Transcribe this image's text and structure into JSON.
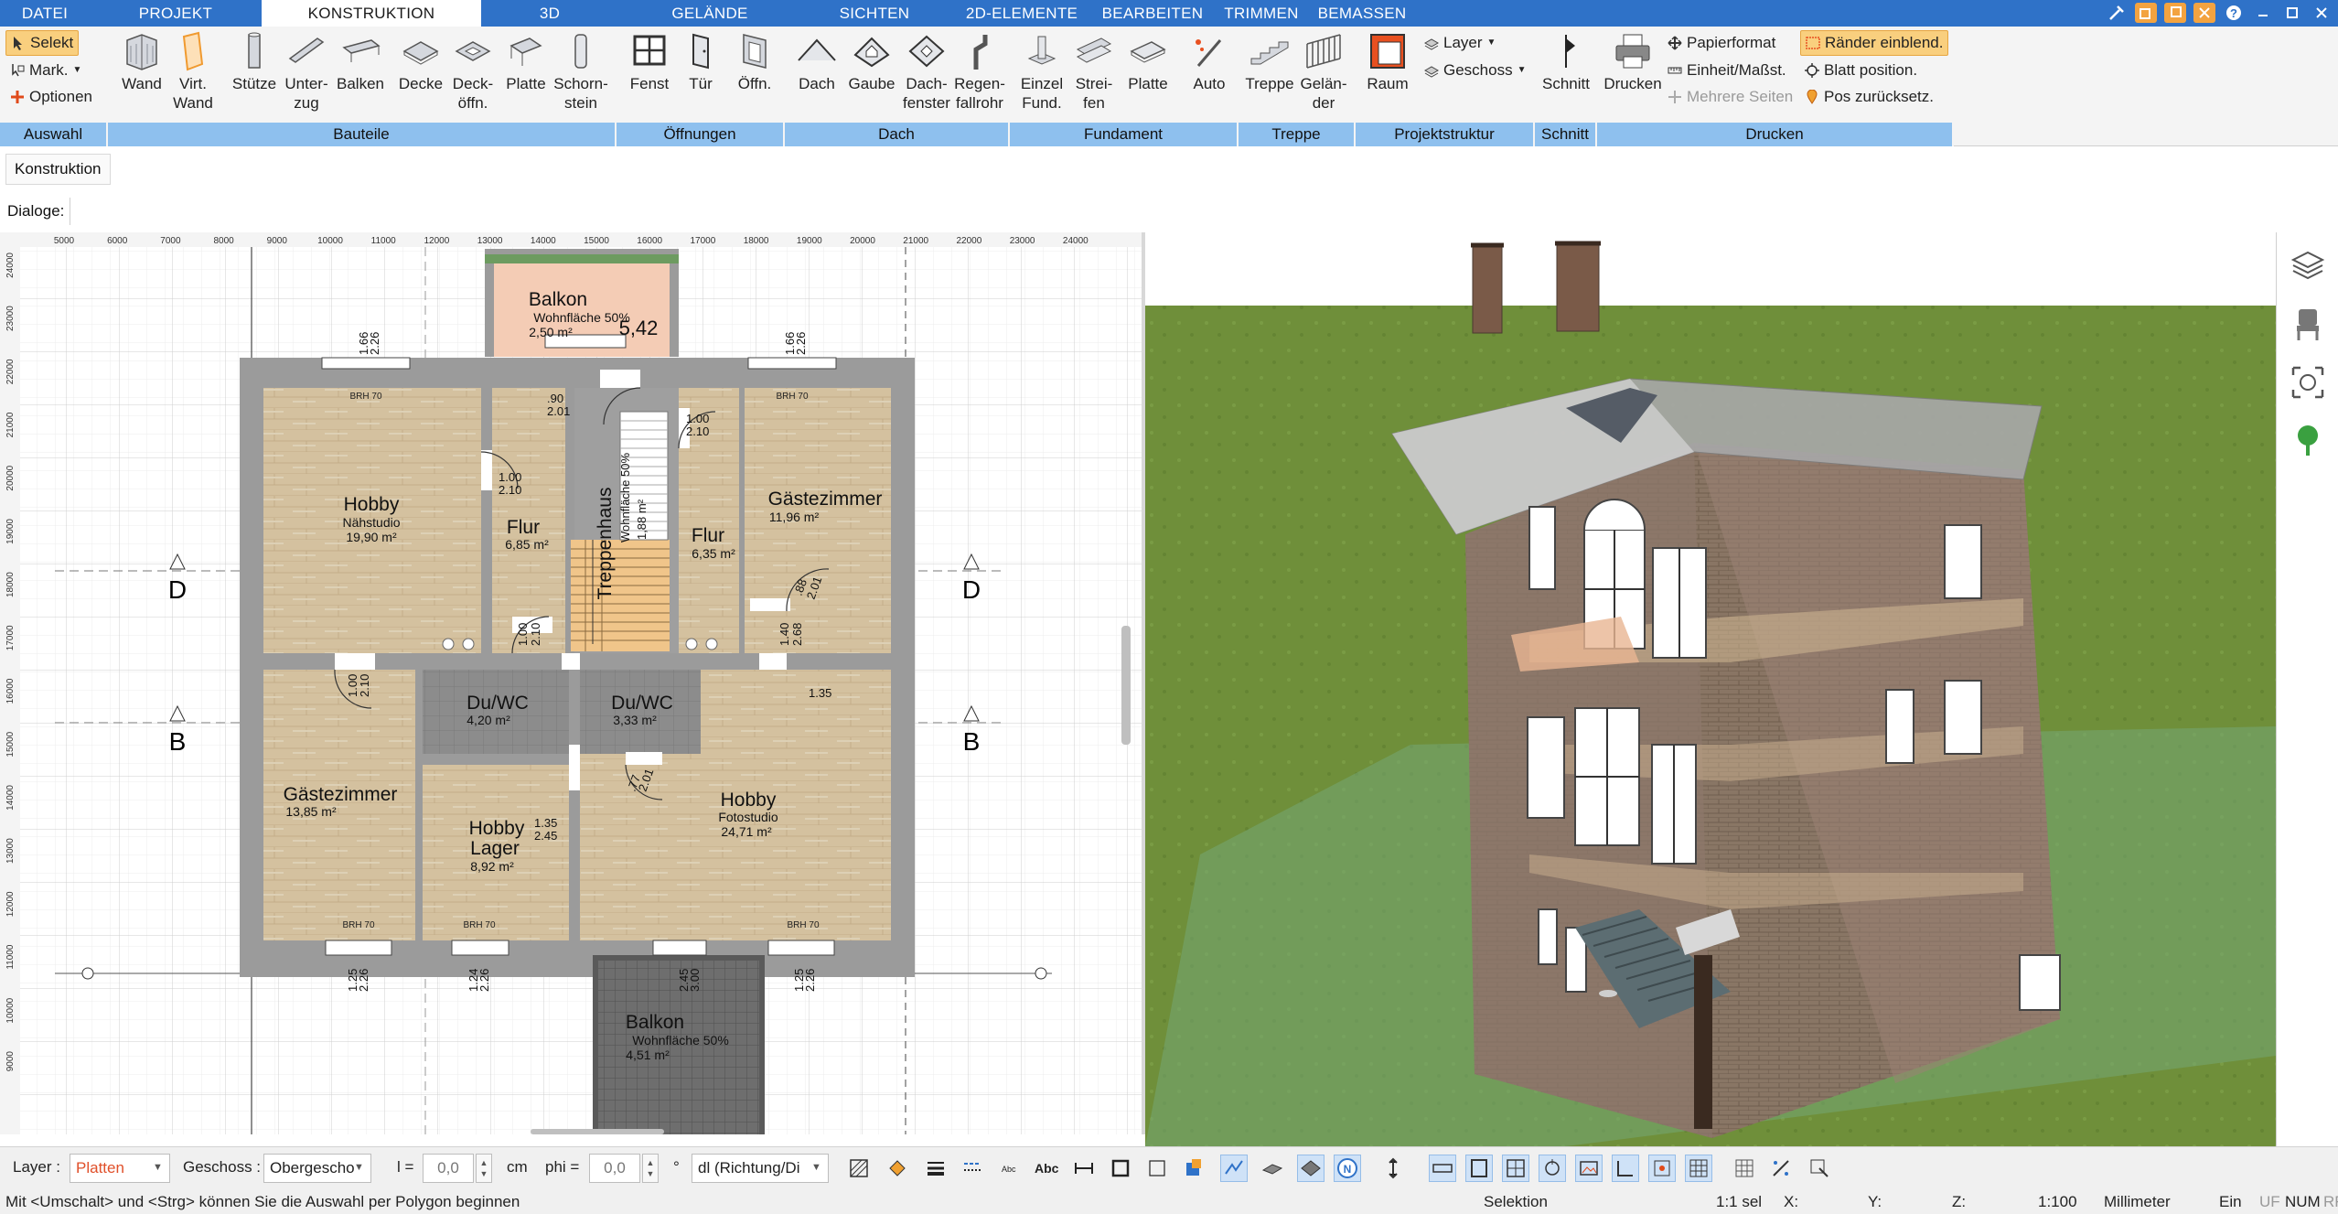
{
  "tabs": [
    "DATEI",
    "PROJEKT",
    "KONSTRUKTION",
    "3D",
    "GELÄNDE",
    "SICHTEN",
    "2D-ELEMENTE",
    "BEARBEITEN",
    "TRIMMEN",
    "BEMASSEN"
  ],
  "ribbon": {
    "auswahl": {
      "selekt": "Selekt",
      "mark": "Mark.",
      "optionen": "Optionen"
    },
    "buttons": {
      "wand": "Wand",
      "virt_wand": "Virt.\nWand",
      "stuetze": "Stütze",
      "unterzug": "Unter-\nzug",
      "balken": "Balken",
      "decke": "Decke",
      "deckoeffn": "Deck-\nöffn.",
      "platte": "Platte",
      "schornstein": "Schorn-\nstein",
      "fenst": "Fenst",
      "tuer": "Tür",
      "oeffn": "Öffn.",
      "dach": "Dach",
      "gaube": "Gaube",
      "dachfenster": "Dach-\nfenster",
      "regenfallrohr": "Regen-\nfallrohr",
      "einzelfund": "Einzel\nFund.",
      "streifen": "Strei-\nfen",
      "platte2": "Platte",
      "auto": "Auto",
      "treppe": "Treppe",
      "gelaender": "Gelän-\nder",
      "raum": "Raum",
      "schnitt": "Schnitt",
      "drucken": "Drucken"
    },
    "projektstruktur": {
      "layer": "Layer",
      "geschoss": "Geschoss"
    },
    "druck": {
      "papierformat": "Papierformat",
      "einheit": "Einheit/Maßst.",
      "mehrere": "Mehrere Seiten",
      "raender": "Ränder einblend.",
      "blatt": "Blatt position.",
      "pos": "Pos zurücksetz."
    },
    "groups": [
      "Auswahl",
      "Bauteile",
      "Öffnungen",
      "Dach",
      "Fundament",
      "Treppe",
      "Projektstruktur",
      "Schnitt",
      "Drucken"
    ]
  },
  "toolbar": {
    "konstruktion": "Konstruktion",
    "dialoge": "Dialoge:"
  },
  "plan": {
    "ruler_x": [
      "5000",
      "6000",
      "7000",
      "8000",
      "9000",
      "10000",
      "11000",
      "12000",
      "13000",
      "14000",
      "15000",
      "16000",
      "17000",
      "18000",
      "19000",
      "20000",
      "21000",
      "22000",
      "23000",
      "24000"
    ],
    "ruler_y": [
      "24000",
      "23000",
      "22000",
      "21000",
      "20000",
      "19000",
      "18000",
      "17000",
      "16000",
      "15000",
      "14000",
      "13000",
      "12000",
      "11000",
      "10000",
      "9000"
    ],
    "rooms": {
      "balkon_top": {
        "name": "Balkon",
        "sub": "Wohnfläche 50%",
        "area": "2,50 m²",
        "dim": "5,42"
      },
      "hobby1": {
        "name": "Hobby",
        "sub": "Nähstudio",
        "area": "19,90 m²"
      },
      "flur1": {
        "name": "Flur",
        "area": "6,85 m²"
      },
      "treppenhaus": {
        "name": "Treppenhaus",
        "sub": "Wohnfläche 50%",
        "area": "1,88 m²"
      },
      "flur2": {
        "name": "Flur",
        "area": "6,35 m²"
      },
      "gast1": {
        "name": "Gästezimmer",
        "area": "11,96 m²"
      },
      "duwc1": {
        "name": "Du/WC",
        "area": "4,20 m²"
      },
      "duwc2": {
        "name": "Du/WC",
        "area": "3,33 m²"
      },
      "gast2": {
        "name": "Gästezimmer",
        "area": "13,85 m²"
      },
      "lager": {
        "name": "Hobby\nLager",
        "area": "8,92 m²"
      },
      "hobby2": {
        "name": "Hobby",
        "sub": "Fotostudio",
        "area": "24,71 m²"
      },
      "balkon_bot": {
        "name": "Balkon",
        "sub": "Wohnfläche 50%",
        "area": "4,51 m²"
      }
    },
    "section_d": "D",
    "section_b": "B",
    "brh": "BRH 70",
    "door_labels": [
      "1.00\n2.10",
      "1.00\n2.10",
      "1.00\n2.10",
      "1.00\n2.10",
      ".90\n2.01",
      "1.35\n2.45",
      ".77\n2.01",
      "2.10\n1.00",
      ".88\n2.01",
      "1.40\n2.68"
    ],
    "window_labels": [
      "1.66\n2.26",
      "1.66\n2.26",
      "1.25\n2.26",
      "1.24\n2.26",
      "1.25\n2.26",
      "2.45\n3.00"
    ]
  },
  "bottom": {
    "layer_label": "Layer :",
    "layer_value": "Platten",
    "geschoss_label": "Geschoss :",
    "geschoss_value": "Obergescho",
    "l_label": "l =",
    "l_value": "0,0",
    "cm": "cm",
    "phi_label": "phi =",
    "phi_value": "0,0",
    "deg": "°",
    "dl_value": "dl (Richtung/Di"
  },
  "status": {
    "hint": "Mit <Umschalt> und <Strg> können Sie die Auswahl per Polygon beginnen",
    "mode": "Selektion",
    "sel": "1:1 sel",
    "x": "X:",
    "y": "Y:",
    "z": "Z:",
    "scale": "1:100",
    "unit": "Millimeter",
    "ein": "Ein",
    "uf": "UF",
    "num": "NUM",
    "rf": "RF"
  },
  "colors": {
    "accent": "#2f72c8",
    "group": "#8ec0ee",
    "selected": "#f9cf7e",
    "wall": "#9b9b9b",
    "floor": "#d6c4a3",
    "tile": "#8a8a8a",
    "balcony": "#f2c8b0",
    "grass": "#6f8f3a"
  }
}
